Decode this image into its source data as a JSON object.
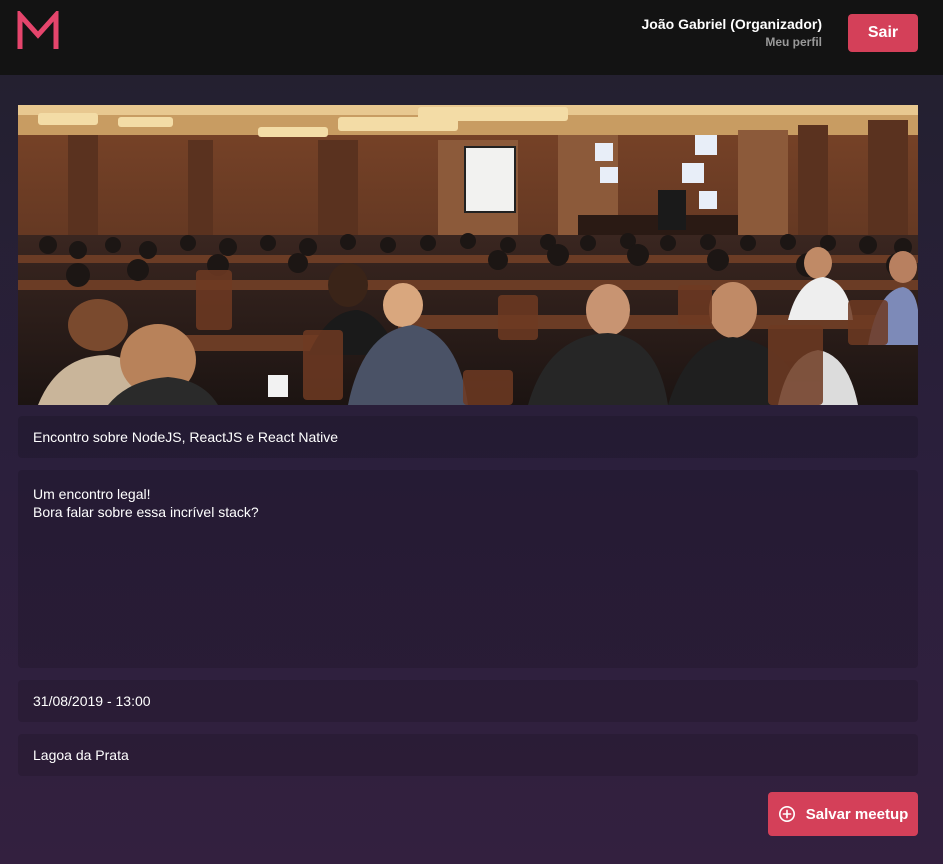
{
  "header": {
    "logo_letter": "M",
    "user_name": "João Gabriel (Organizador)",
    "profile_link": "Meu perfil",
    "exit_label": "Sair"
  },
  "meetup": {
    "banner_image": "conference-hall-photo",
    "title": "Encontro sobre NodeJS, ReactJS e React Native",
    "description": "Um encontro legal!\nBora falar sobre essa incrível stack?",
    "date": "31/08/2019 - 13:00",
    "location": "Lagoa da Prata"
  },
  "actions": {
    "save_label": "Salvar meetup",
    "save_icon": "add-circle-icon"
  },
  "colors": {
    "accent": "#d44059",
    "header_bg": "#131313",
    "muted_text": "#999999"
  }
}
